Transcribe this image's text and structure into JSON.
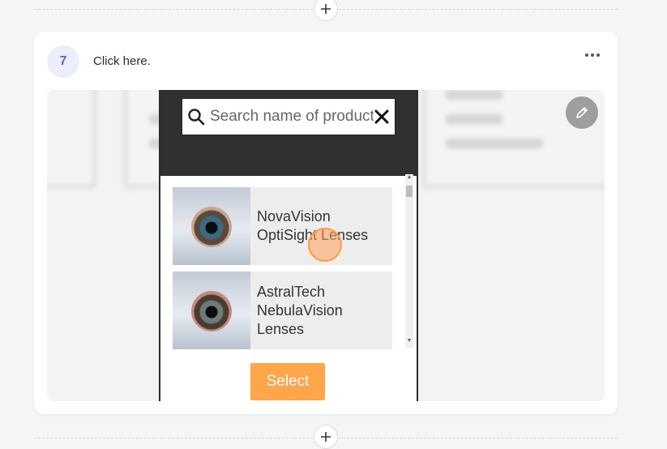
{
  "step": {
    "number": "7",
    "instruction": "Click here."
  },
  "screenshot": {
    "search": {
      "placeholder": "Search name of product"
    },
    "products": [
      {
        "name_line1": "NovaVision",
        "name_line2": "OptiSight Lenses",
        "name_line3": ""
      },
      {
        "name_line1": "AstralTech",
        "name_line2": "NebulaVision",
        "name_line3": "Lenses"
      }
    ],
    "select_label": "Select"
  },
  "icons": {
    "add_above": "plus-icon",
    "add_below": "plus-icon",
    "more": "more-horizontal-icon",
    "edit": "pencil-icon",
    "search": "search-icon",
    "clear": "close-icon"
  },
  "colors": {
    "accent_badge": "#5865d4",
    "select_button": "#ffa54a",
    "click_marker": "#ff9a4a"
  }
}
